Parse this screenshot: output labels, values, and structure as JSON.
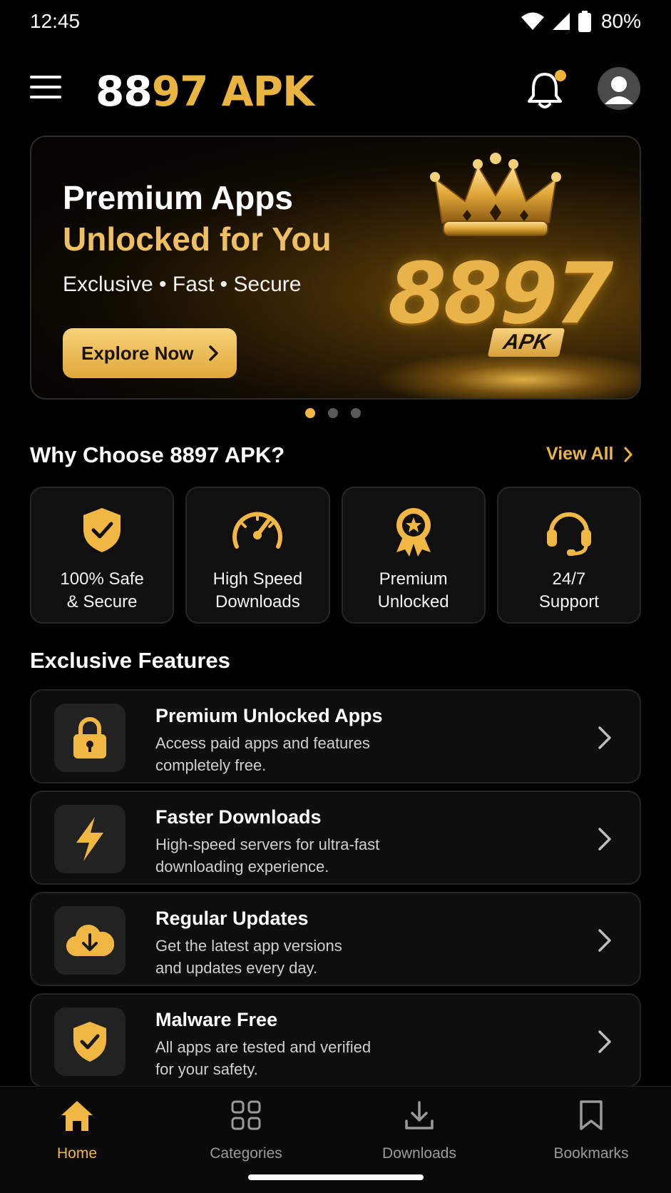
{
  "status_bar": {
    "time": "12:45",
    "battery": "80%"
  },
  "header": {
    "brand_part1": "88",
    "brand_part2": "97 APK"
  },
  "hero": {
    "title_line1": "Premium Apps",
    "title_line2": "Unlocked for You",
    "subtitle": "Exclusive • Fast • Secure",
    "cta_label": "Explore Now",
    "logo_number": "8897",
    "logo_badge": "APK"
  },
  "carousel": {
    "page_count": 3,
    "active_index": 0
  },
  "why_choose": {
    "title": "Why Choose 8897 APK?",
    "view_all_label": "View All",
    "features": [
      {
        "line1": "100% Safe",
        "line2": "& Secure",
        "icon": "shield-check-icon"
      },
      {
        "line1": "High Speed",
        "line2": "Downloads",
        "icon": "speedometer-icon"
      },
      {
        "line1": "Premium",
        "line2": "Unlocked",
        "icon": "award-badge-icon"
      },
      {
        "line1": "24/7",
        "line2": "Support",
        "icon": "headset-icon"
      }
    ]
  },
  "exclusive": {
    "title": "Exclusive Features",
    "items": [
      {
        "title": "Premium Unlocked Apps",
        "desc_line1": "Access paid apps and features",
        "desc_line2": "completely free.",
        "icon": "lock-icon"
      },
      {
        "title": "Faster Downloads",
        "desc_line1": "High-speed servers for ultra-fast",
        "desc_line2": "downloading experience.",
        "icon": "lightning-icon"
      },
      {
        "title": "Regular Updates",
        "desc_line1": "Get the latest app versions",
        "desc_line2": "and updates every day.",
        "icon": "cloud-download-icon"
      },
      {
        "title": "Malware Free",
        "desc_line1": "All apps are tested and verified",
        "desc_line2": "for your safety.",
        "icon": "shield-check-icon"
      }
    ]
  },
  "bottom_nav": [
    {
      "label": "Home",
      "icon": "home-icon",
      "active": true
    },
    {
      "label": "Categories",
      "icon": "grid-icon",
      "active": false
    },
    {
      "label": "Downloads",
      "icon": "download-icon",
      "active": false
    },
    {
      "label": "Bookmarks",
      "icon": "bookmark-icon",
      "active": false
    }
  ],
  "colors": {
    "accent": "#F0B843",
    "background": "#000000",
    "card": "#101010"
  }
}
